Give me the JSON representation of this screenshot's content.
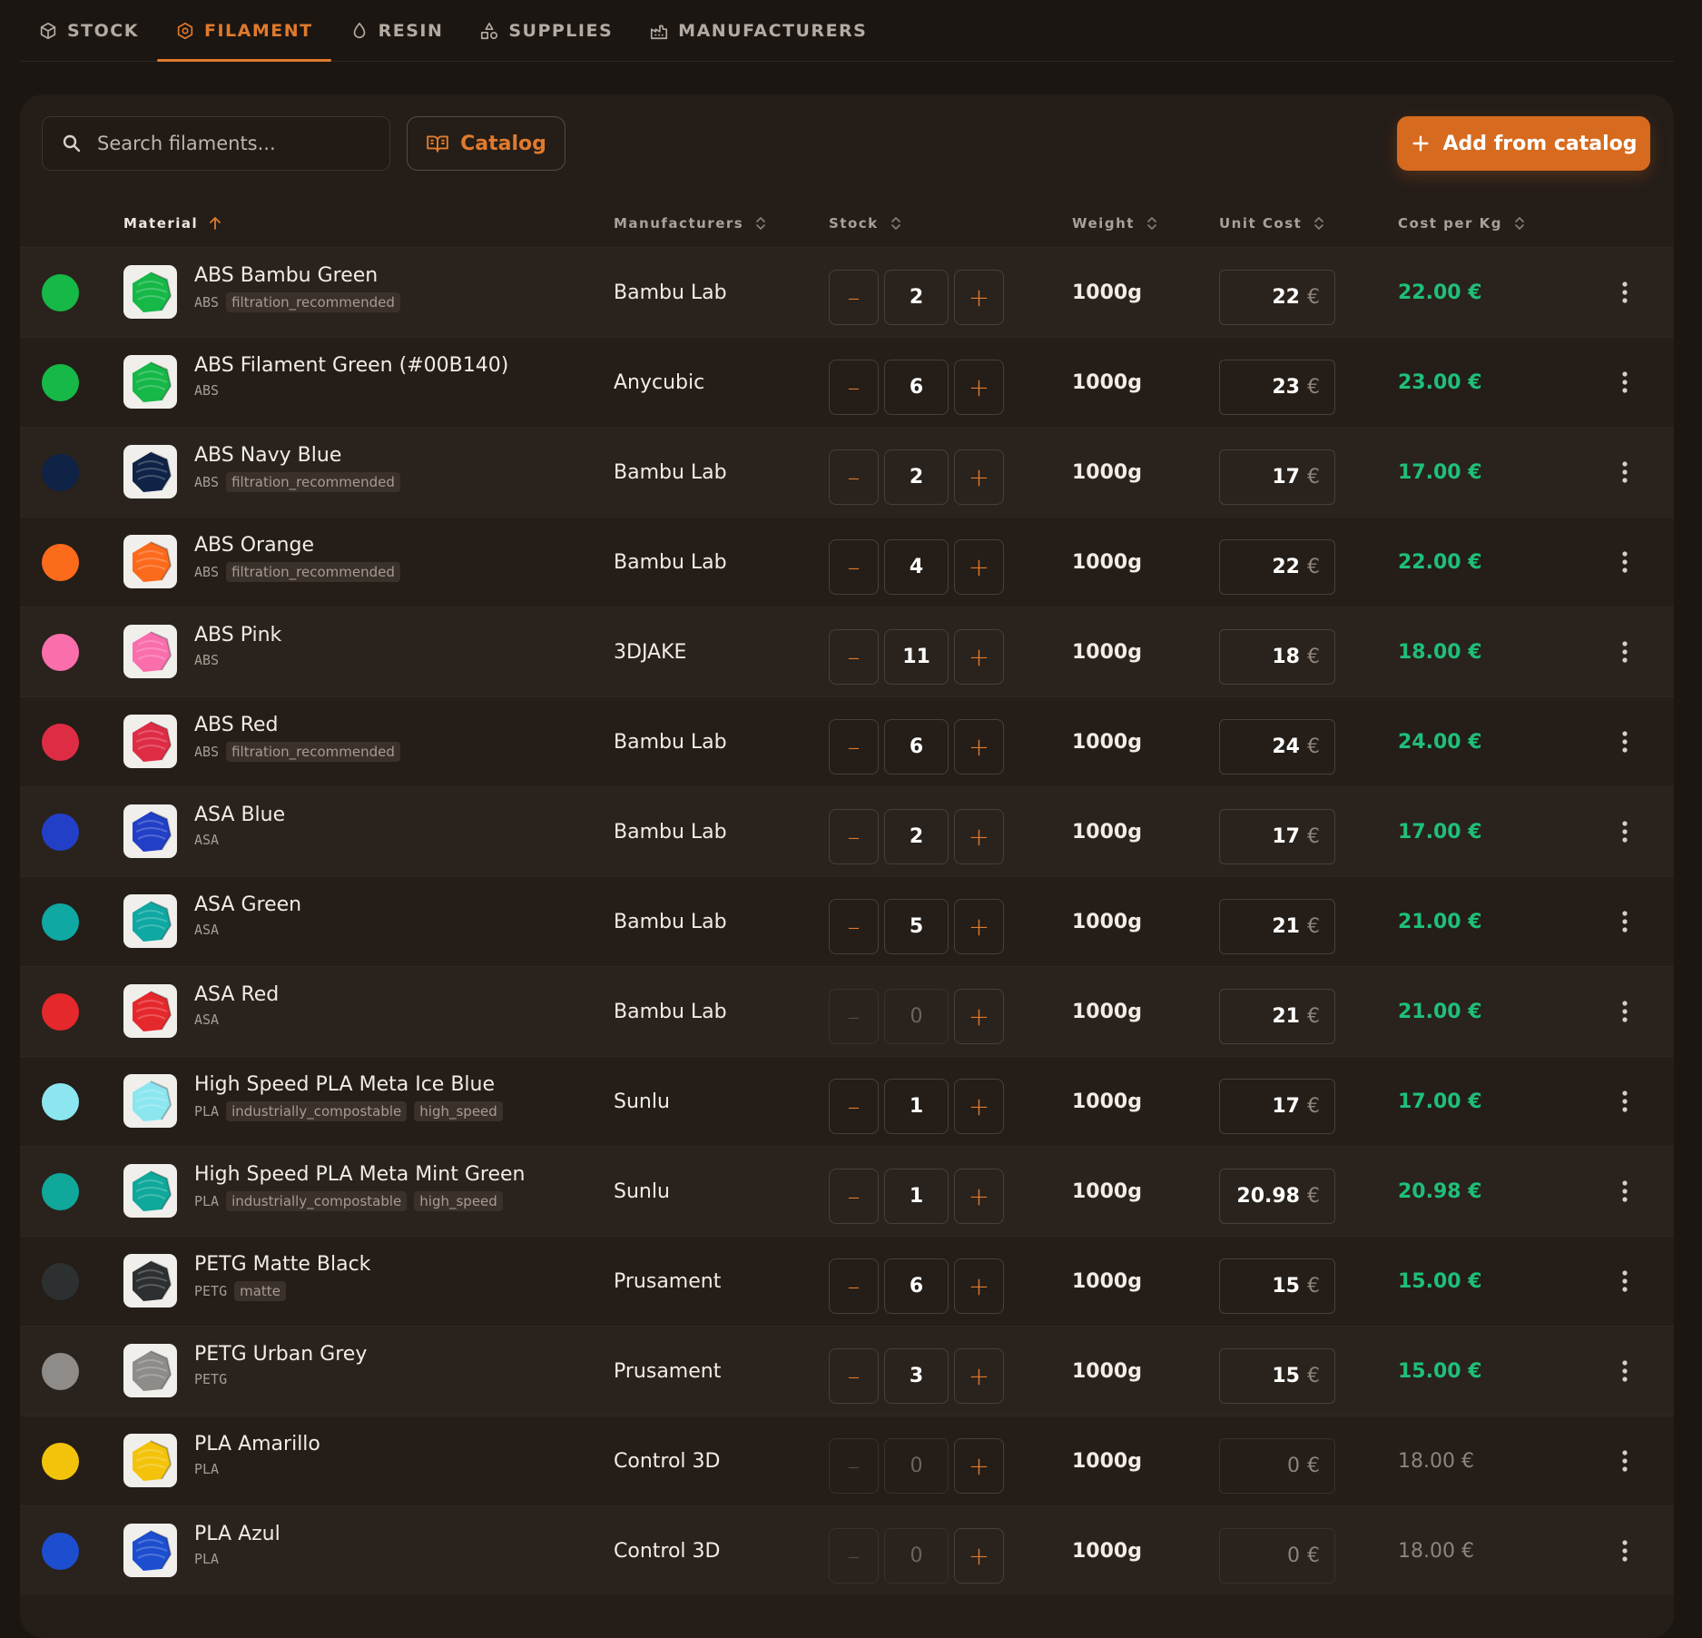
{
  "tabs": [
    {
      "label": "STOCK"
    },
    {
      "label": "FILAMENT"
    },
    {
      "label": "RESIN"
    },
    {
      "label": "SUPPLIES"
    },
    {
      "label": "MANUFACTURERS"
    }
  ],
  "active_tab": "FILAMENT",
  "toolbar": {
    "search_placeholder": "Search filaments...",
    "catalog_label": "Catalog",
    "add_label": "Add from catalog"
  },
  "columns": {
    "material": "Material",
    "manufacturers": "Manufacturers",
    "stock": "Stock",
    "weight": "Weight",
    "unit_cost": "Unit Cost",
    "cost_per_kg": "Cost per Kg"
  },
  "colors": {
    "accent": "#e07a2c",
    "positive": "#1fbf7a"
  },
  "currency": "€",
  "rows": [
    {
      "color": "#16b847",
      "thumb": "spool-green",
      "name": "ABS Bambu Green",
      "type": "ABS",
      "tags": [
        "filtration_recommended"
      ],
      "manufacturer": "Bambu Lab",
      "stock": 2,
      "weight": "1000g",
      "unit_cost": "22",
      "cost_per_kg": "22.00 €"
    },
    {
      "color": "#16b847",
      "thumb": "spool-green-ribbed",
      "name": "ABS Filament Green (#00B140)",
      "type": "ABS",
      "tags": [],
      "manufacturer": "Anycubic",
      "stock": 6,
      "weight": "1000g",
      "unit_cost": "23",
      "cost_per_kg": "23.00 €"
    },
    {
      "color": "#0e2346",
      "thumb": "spool-navy",
      "name": "ABS Navy Blue",
      "type": "ABS",
      "tags": [
        "filtration_recommended"
      ],
      "manufacturer": "Bambu Lab",
      "stock": 2,
      "weight": "1000g",
      "unit_cost": "17",
      "cost_per_kg": "17.00 €"
    },
    {
      "color": "#fc6a1c",
      "thumb": "spool-orange",
      "name": "ABS Orange",
      "type": "ABS",
      "tags": [
        "filtration_recommended"
      ],
      "manufacturer": "Bambu Lab",
      "stock": 4,
      "weight": "1000g",
      "unit_cost": "22",
      "cost_per_kg": "22.00 €"
    },
    {
      "color": "#fa6eac",
      "thumb": "spool-pink",
      "name": "ABS Pink",
      "type": "ABS",
      "tags": [],
      "manufacturer": "3DJAKE",
      "stock": 11,
      "weight": "1000g",
      "unit_cost": "18",
      "cost_per_kg": "18.00 €"
    },
    {
      "color": "#df2c45",
      "thumb": "spool-red",
      "name": "ABS Red",
      "type": "ABS",
      "tags": [
        "filtration_recommended"
      ],
      "manufacturer": "Bambu Lab",
      "stock": 6,
      "weight": "1000g",
      "unit_cost": "24",
      "cost_per_kg": "24.00 €"
    },
    {
      "color": "#223fc7",
      "thumb": "spool-blue",
      "name": "ASA Blue",
      "type": "ASA",
      "tags": [],
      "manufacturer": "Bambu Lab",
      "stock": 2,
      "weight": "1000g",
      "unit_cost": "17",
      "cost_per_kg": "17.00 €"
    },
    {
      "color": "#0fa8a2",
      "thumb": "spool-teal",
      "name": "ASA Green",
      "type": "ASA",
      "tags": [],
      "manufacturer": "Bambu Lab",
      "stock": 5,
      "weight": "1000g",
      "unit_cost": "21",
      "cost_per_kg": "21.00 €"
    },
    {
      "color": "#e4282c",
      "thumb": "spool-red-light",
      "name": "ASA Red",
      "type": "ASA",
      "tags": [],
      "manufacturer": "Bambu Lab",
      "stock": 0,
      "weight": "1000g",
      "unit_cost": "21",
      "cost_per_kg": "21.00 €"
    },
    {
      "color": "#8ce6f0",
      "thumb": "spool-ice-blue",
      "name": "High Speed PLA Meta Ice Blue",
      "type": "PLA",
      "tags": [
        "industrially_compostable",
        "high_speed"
      ],
      "manufacturer": "Sunlu",
      "stock": 1,
      "weight": "1000g",
      "unit_cost": "17",
      "cost_per_kg": "17.00 €"
    },
    {
      "color": "#0fa89a",
      "thumb": "spool-mint-green",
      "name": "High Speed PLA Meta Mint Green",
      "type": "PLA",
      "tags": [
        "industrially_compostable",
        "high_speed"
      ],
      "manufacturer": "Sunlu",
      "stock": 1,
      "weight": "1000g",
      "unit_cost": "20.98",
      "cost_per_kg": "20.98 €"
    },
    {
      "color": "#2c3030",
      "thumb": "spool-black",
      "name": "PETG Matte Black",
      "type": "PETG",
      "tags": [
        "matte"
      ],
      "manufacturer": "Prusament",
      "stock": 6,
      "weight": "1000g",
      "unit_cost": "15",
      "cost_per_kg": "15.00 €"
    },
    {
      "color": "#8f8b88",
      "thumb": "spool-grey",
      "name": "PETG Urban Grey",
      "type": "PETG",
      "tags": [],
      "manufacturer": "Prusament",
      "stock": 3,
      "weight": "1000g",
      "unit_cost": "15",
      "cost_per_kg": "15.00 €"
    },
    {
      "color": "#f3c30c",
      "thumb": "spool-yellow-box",
      "name": "PLA Amarillo",
      "type": "PLA",
      "tags": [],
      "manufacturer": "Control 3D",
      "stock": 0,
      "weight": "1000g",
      "unit_cost": "0",
      "cost_per_kg": "18.00 €"
    },
    {
      "color": "#1c4ecf",
      "thumb": "spool-blue-box",
      "name": "PLA Azul",
      "type": "PLA",
      "tags": [],
      "manufacturer": "Control 3D",
      "stock": 0,
      "weight": "1000g",
      "unit_cost": "0",
      "cost_per_kg": "18.00 €"
    }
  ]
}
